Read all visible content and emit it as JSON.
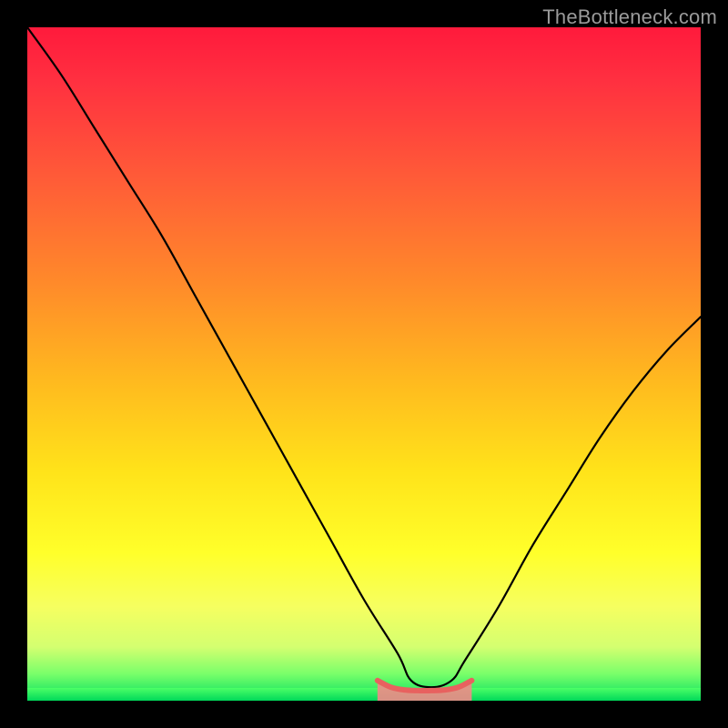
{
  "watermark": "TheBottleneck.com",
  "colors": {
    "frame": "#000000",
    "curve": "#000000",
    "bump_stroke": "#e8615f",
    "bump_fill": "#f08a88",
    "grad_top": "#ff1a3c",
    "grad_mid": "#ffe31a",
    "grad_bottom": "#00e060"
  },
  "chart_data": {
    "type": "line",
    "title": "",
    "xlabel": "",
    "ylabel": "",
    "xlim": [
      0,
      100
    ],
    "ylim": [
      0,
      100
    ],
    "note": "Axes are unlabeled; values approximate from pixel position. y=0 at bottom (green), y=100 at top (red).",
    "series": [
      {
        "name": "main-curve",
        "x": [
          0,
          5,
          10,
          15,
          20,
          25,
          30,
          35,
          40,
          45,
          50,
          55,
          57,
          60,
          63,
          65,
          70,
          75,
          80,
          85,
          90,
          95,
          100
        ],
        "y": [
          100,
          93,
          85,
          77,
          69,
          60,
          51,
          42,
          33,
          24,
          15,
          7,
          3,
          2,
          3,
          6,
          14,
          23,
          31,
          39,
          46,
          52,
          57
        ]
      },
      {
        "name": "bottom-bump",
        "x": [
          52,
          54,
          56,
          58,
          60,
          62,
          64,
          66
        ],
        "y": [
          3.0,
          2.0,
          1.6,
          1.5,
          1.5,
          1.6,
          2.0,
          3.0
        ]
      }
    ]
  }
}
